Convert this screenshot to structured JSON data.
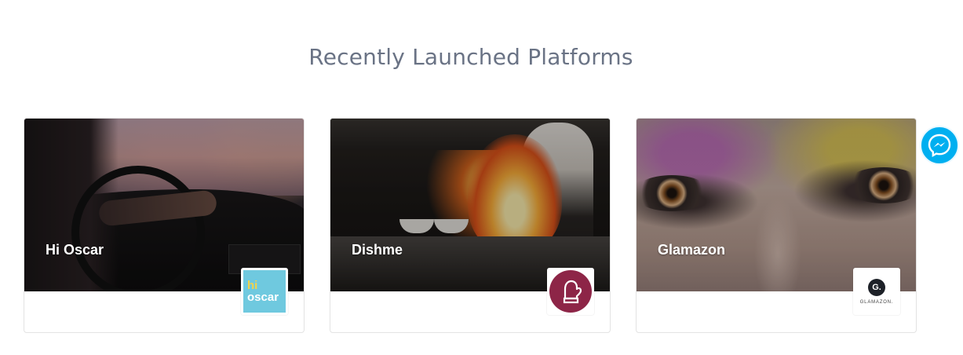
{
  "section": {
    "title": "Recently Launched Platforms"
  },
  "platforms": [
    {
      "name": "Hi Oscar",
      "logo": {
        "line1": "hi",
        "line2": "oscar",
        "icon": "hi-oscar-logo",
        "color": "#6fc9df"
      }
    },
    {
      "name": "Dishme",
      "logo": {
        "icon": "oven-mitt-icon",
        "color": "#8d2547"
      }
    },
    {
      "name": "Glamazon",
      "logo": {
        "initial": "G.",
        "word": "GLAMAZON.",
        "icon": "glamazon-logo",
        "color": "#1d2128"
      }
    }
  ],
  "messenger": {
    "icon": "messenger-icon",
    "color": "#00aff0"
  }
}
